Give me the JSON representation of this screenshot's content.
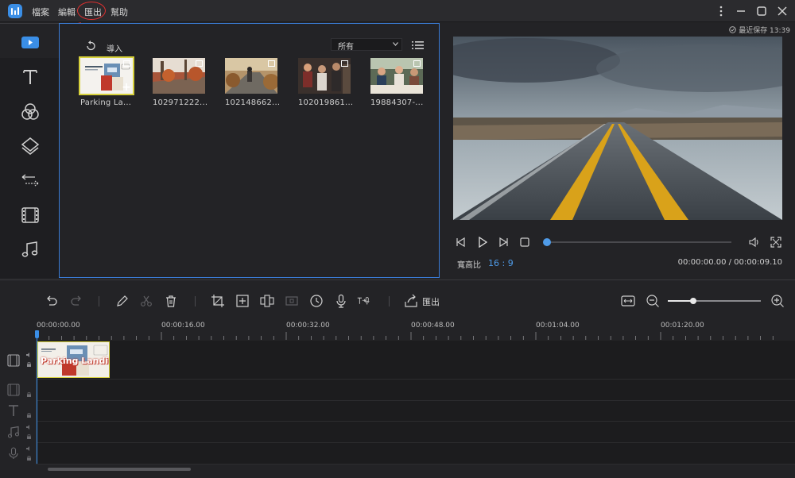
{
  "titlebar": {
    "menus": [
      "檔案",
      "編輯",
      "匯出",
      "幫助"
    ]
  },
  "library": {
    "import_label": "導入",
    "filter": "所有",
    "items": [
      {
        "name": "Parking La...",
        "selected": true
      },
      {
        "name": "102971222..."
      },
      {
        "name": "102148662..."
      },
      {
        "name": "102019861..."
      },
      {
        "name": "19884307-..."
      }
    ]
  },
  "preview": {
    "autosave": "最近保存 13:39",
    "ratio_label": "寬高比",
    "ratio_value": "16 : 9",
    "timecode": "00:00:00.00 / 00:00:09.10",
    "progress": 0
  },
  "toolbar": {
    "export_label": "匯出",
    "zoom_level": 0.27
  },
  "timeline": {
    "ruler": [
      "00:00:00.00",
      "00:00:16.00",
      "00:00:32.00",
      "00:00:48.00",
      "00:01:04.00",
      "00:01:20.00"
    ],
    "clip_text": "Parking Landing"
  },
  "colors": {
    "accent": "#3a8ee6",
    "selection": "#d7d13c",
    "annotation": "#e03030"
  }
}
